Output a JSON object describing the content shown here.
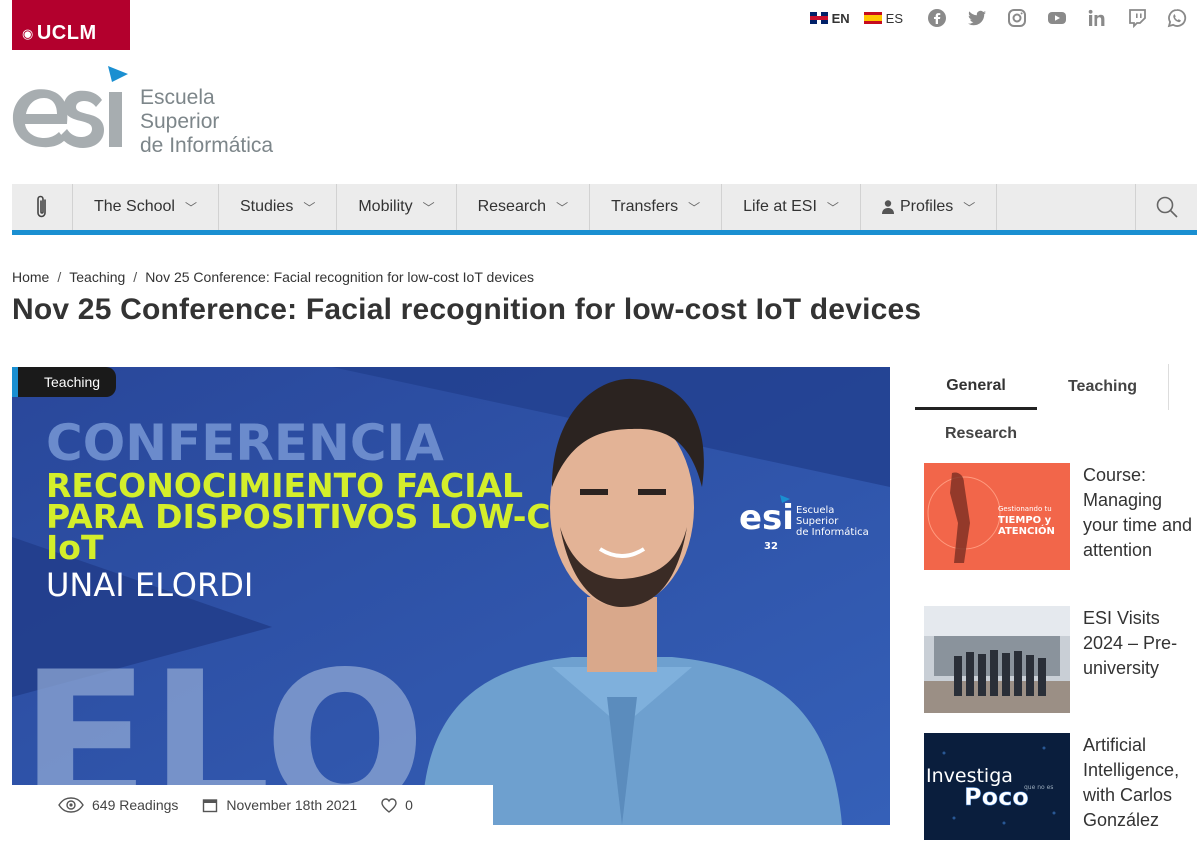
{
  "topbar": {
    "brand": "UCLM",
    "languages": [
      {
        "code": "EN",
        "active": true
      },
      {
        "code": "ES",
        "active": false
      }
    ],
    "social_icons": [
      "facebook-icon",
      "twitter-icon",
      "instagram-icon",
      "youtube-icon",
      "linkedin-icon",
      "twitch-icon",
      "whatsapp-icon"
    ]
  },
  "logo": {
    "line1": "Escuela",
    "line2": "Superior",
    "line3": "de Informática"
  },
  "nav": {
    "items": [
      {
        "label": "The School"
      },
      {
        "label": "Studies"
      },
      {
        "label": "Mobility"
      },
      {
        "label": "Research"
      },
      {
        "label": "Transfers"
      },
      {
        "label": "Life at ESI"
      },
      {
        "label": "Profiles"
      }
    ]
  },
  "breadcrumb": {
    "home": "Home",
    "section": "Teaching",
    "current": "Nov 25 Conference: Facial recognition for low-cost IoT devices"
  },
  "page_title": "Nov 25 Conference: Facial recognition for low-cost IoT devices",
  "hero": {
    "category": "Teaching",
    "poster_heading": "CONFERENCIA",
    "poster_line1": "RECONOCIMIENTO FACIAL",
    "poster_line2": "PARA DISPOSITIVOS LOW-COST",
    "poster_line3": "IoT",
    "poster_speaker": "UNAI ELORDI",
    "poster_bg_text": "ELO",
    "poster_logo_1": "Escuela",
    "poster_logo_2": "Superior",
    "poster_logo_3": "de Informática",
    "poster_years": "32"
  },
  "meta": {
    "readings": "649 Readings",
    "date": "November 18th 2021",
    "likes": "0"
  },
  "sidebar": {
    "tabs": [
      "General",
      "Teaching",
      "Research"
    ],
    "items": [
      {
        "title": "Course: Managing your time and attention",
        "thumb_text_1": "Gestionando tu",
        "thumb_text_2": "TIEMPO y",
        "thumb_text_3": "ATENCIÓN"
      },
      {
        "title": "ESI Visits 2024 – Pre-university"
      },
      {
        "title": "Artificial Intelligence, with Carlos González",
        "thumb_text_1": "Investiga",
        "thumb_text_2": "Poco",
        "thumb_text_3": "que no es"
      }
    ]
  },
  "colors": {
    "brand_red": "#b3002d",
    "accent_blue": "#1a8fd1",
    "poster_blue": "#2f4f9e",
    "poster_yellow": "#d4ee2b"
  }
}
